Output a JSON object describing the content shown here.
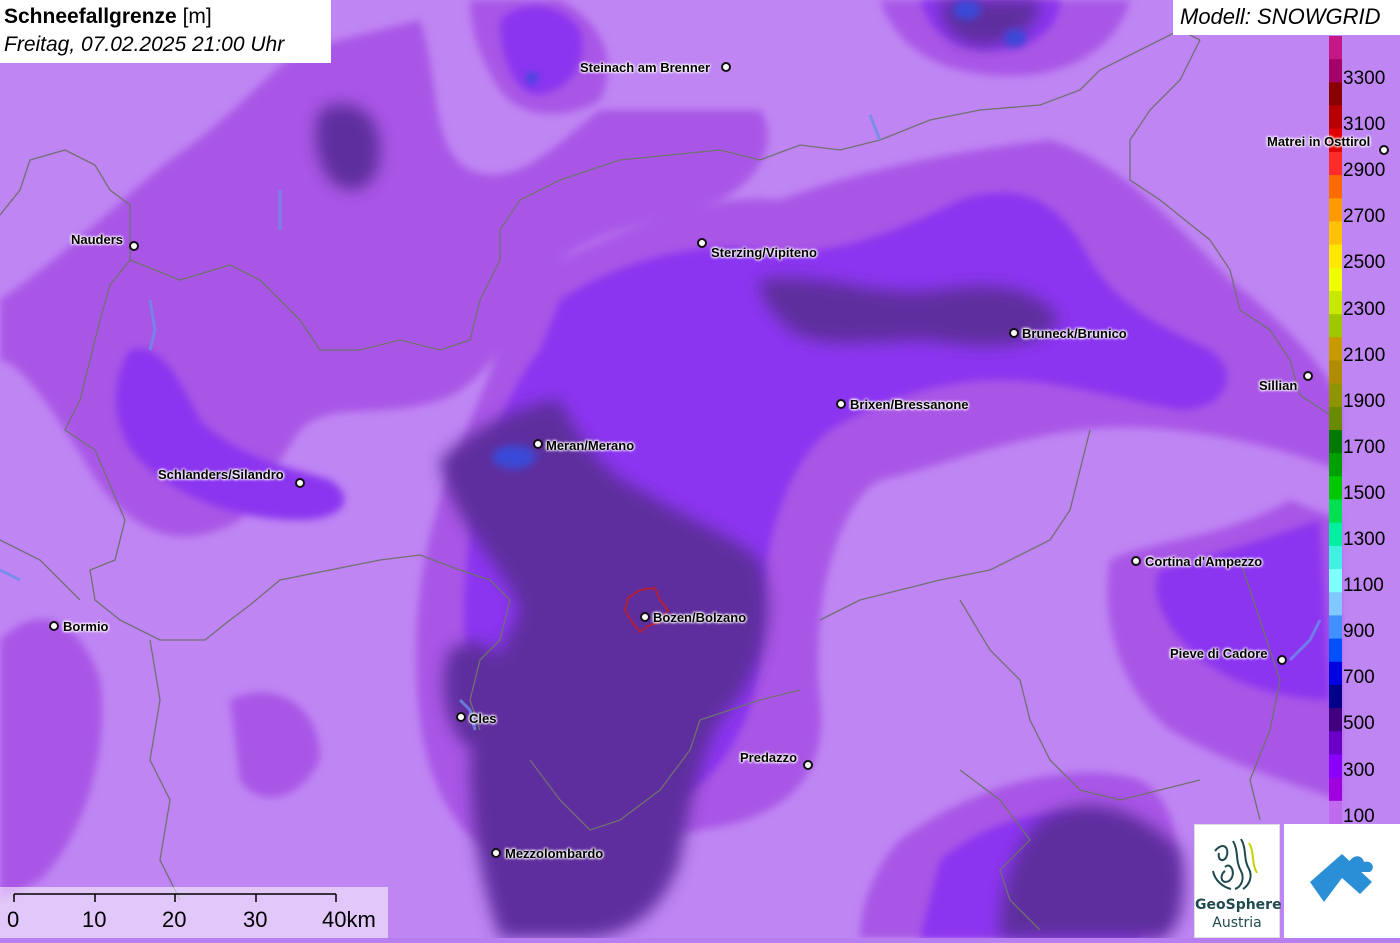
{
  "header": {
    "title_bold": "Schneefallgrenze",
    "title_unit": "[m]",
    "subtitle": "Freitag, 07.02.2025 21:00 Uhr"
  },
  "model": {
    "label": "Modell: SNOWGRID"
  },
  "legend": {
    "labels": [
      "3300",
      "3100",
      "2900",
      "2700",
      "2500",
      "2300",
      "2100",
      "1900",
      "1700",
      "1500",
      "1300",
      "1100",
      "900",
      "700",
      "500",
      "300",
      "100"
    ],
    "colors": [
      "#c51887",
      "#a3006a",
      "#8a0000",
      "#b80000",
      "#e00000",
      "#ff2a2a",
      "#ff6a00",
      "#ff9a00",
      "#ffc200",
      "#ffe800",
      "#f0ff00",
      "#c8e800",
      "#a0c800",
      "#c89a00",
      "#b08c00",
      "#909400",
      "#6a8a00",
      "#007a00",
      "#00a000",
      "#00c800",
      "#00e050",
      "#00f0a0",
      "#40f0e0",
      "#80ffff",
      "#80c8ff",
      "#4090ff",
      "#0050ff",
      "#0000e0",
      "#00008a",
      "#400080",
      "#6a00c8",
      "#8a00ff",
      "#a000e0",
      "#c06af0"
    ]
  },
  "cities": [
    {
      "name": "Steinach am Brenner"
    },
    {
      "name": "Nauders"
    },
    {
      "name": "Sterzing/Vipiteno"
    },
    {
      "name": "Bruneck/Brunico"
    },
    {
      "name": "Brixen/Bressanone"
    },
    {
      "name": "Sillian"
    },
    {
      "name": "Matrei in Osttirol"
    },
    {
      "name": "Meran/Merano"
    },
    {
      "name": "Schlanders/Silandro"
    },
    {
      "name": "Cortina d'Ampezzo"
    },
    {
      "name": "Bormio"
    },
    {
      "name": "Bozen/Bolzano"
    },
    {
      "name": "Pieve di Cadore"
    },
    {
      "name": "Cles"
    },
    {
      "name": "Predazzo"
    },
    {
      "name": "Mezzolombardo"
    }
  ],
  "scale": {
    "ticks": [
      "0",
      "10",
      "20",
      "30",
      "40km"
    ]
  },
  "logos": {
    "geosphere_line1": "GeoSphere",
    "geosphere_line2": "Austria"
  },
  "colors": {
    "light_band": "#c090f5",
    "mid_band": "#a45ae8",
    "bright_band": "#8a2ff0",
    "dark_band": "#5a2f9a",
    "blue_band": "#2e3fd0",
    "border_line": "#707070"
  }
}
